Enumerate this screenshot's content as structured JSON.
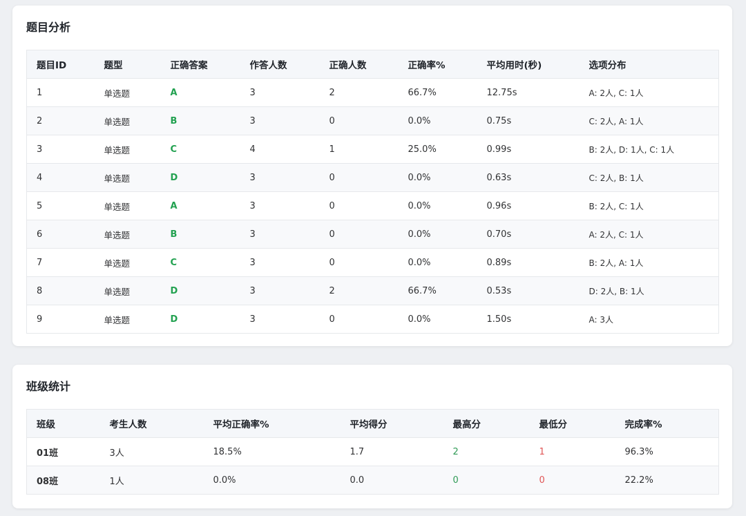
{
  "question_analysis": {
    "title": "题目分析",
    "columns": [
      "题目ID",
      "题型",
      "正确答案",
      "作答人数",
      "正确人数",
      "正确率%",
      "平均用时(秒)",
      "选项分布"
    ],
    "rows": [
      [
        "1",
        "单选题",
        "A",
        "3",
        "2",
        "66.7%",
        "12.75s",
        "A: 2人, C: 1人"
      ],
      [
        "2",
        "单选题",
        "B",
        "3",
        "0",
        "0.0%",
        "0.75s",
        "C: 2人, A: 1人"
      ],
      [
        "3",
        "单选题",
        "C",
        "4",
        "1",
        "25.0%",
        "0.99s",
        "B: 2人, D: 1人, C: 1人"
      ],
      [
        "4",
        "单选题",
        "D",
        "3",
        "0",
        "0.0%",
        "0.63s",
        "C: 2人, B: 1人"
      ],
      [
        "5",
        "单选题",
        "A",
        "3",
        "0",
        "0.0%",
        "0.96s",
        "B: 2人, C: 1人"
      ],
      [
        "6",
        "单选题",
        "B",
        "3",
        "0",
        "0.0%",
        "0.70s",
        "A: 2人, C: 1人"
      ],
      [
        "7",
        "单选题",
        "C",
        "3",
        "0",
        "0.0%",
        "0.89s",
        "B: 2人, A: 1人"
      ],
      [
        "8",
        "单选题",
        "D",
        "3",
        "2",
        "66.7%",
        "0.53s",
        "D: 2人, B: 1人"
      ],
      [
        "9",
        "单选题",
        "D",
        "3",
        "0",
        "0.0%",
        "1.50s",
        "A: 3人"
      ]
    ]
  },
  "class_stats": {
    "title": "班级统计",
    "columns": [
      "班级",
      "考生人数",
      "平均正确率%",
      "平均得分",
      "最高分",
      "最低分",
      "完成率%"
    ],
    "rows": [
      [
        "01班",
        "3人",
        "18.5%",
        "1.7",
        "2",
        "1",
        "96.3%"
      ],
      [
        "08班",
        "1人",
        "0.0%",
        "0.0",
        "0",
        "0",
        "22.2%"
      ]
    ]
  },
  "colors": {
    "answer": "#22a150",
    "highest_score": "#2f9a55",
    "lowest_score": "#e05555"
  }
}
